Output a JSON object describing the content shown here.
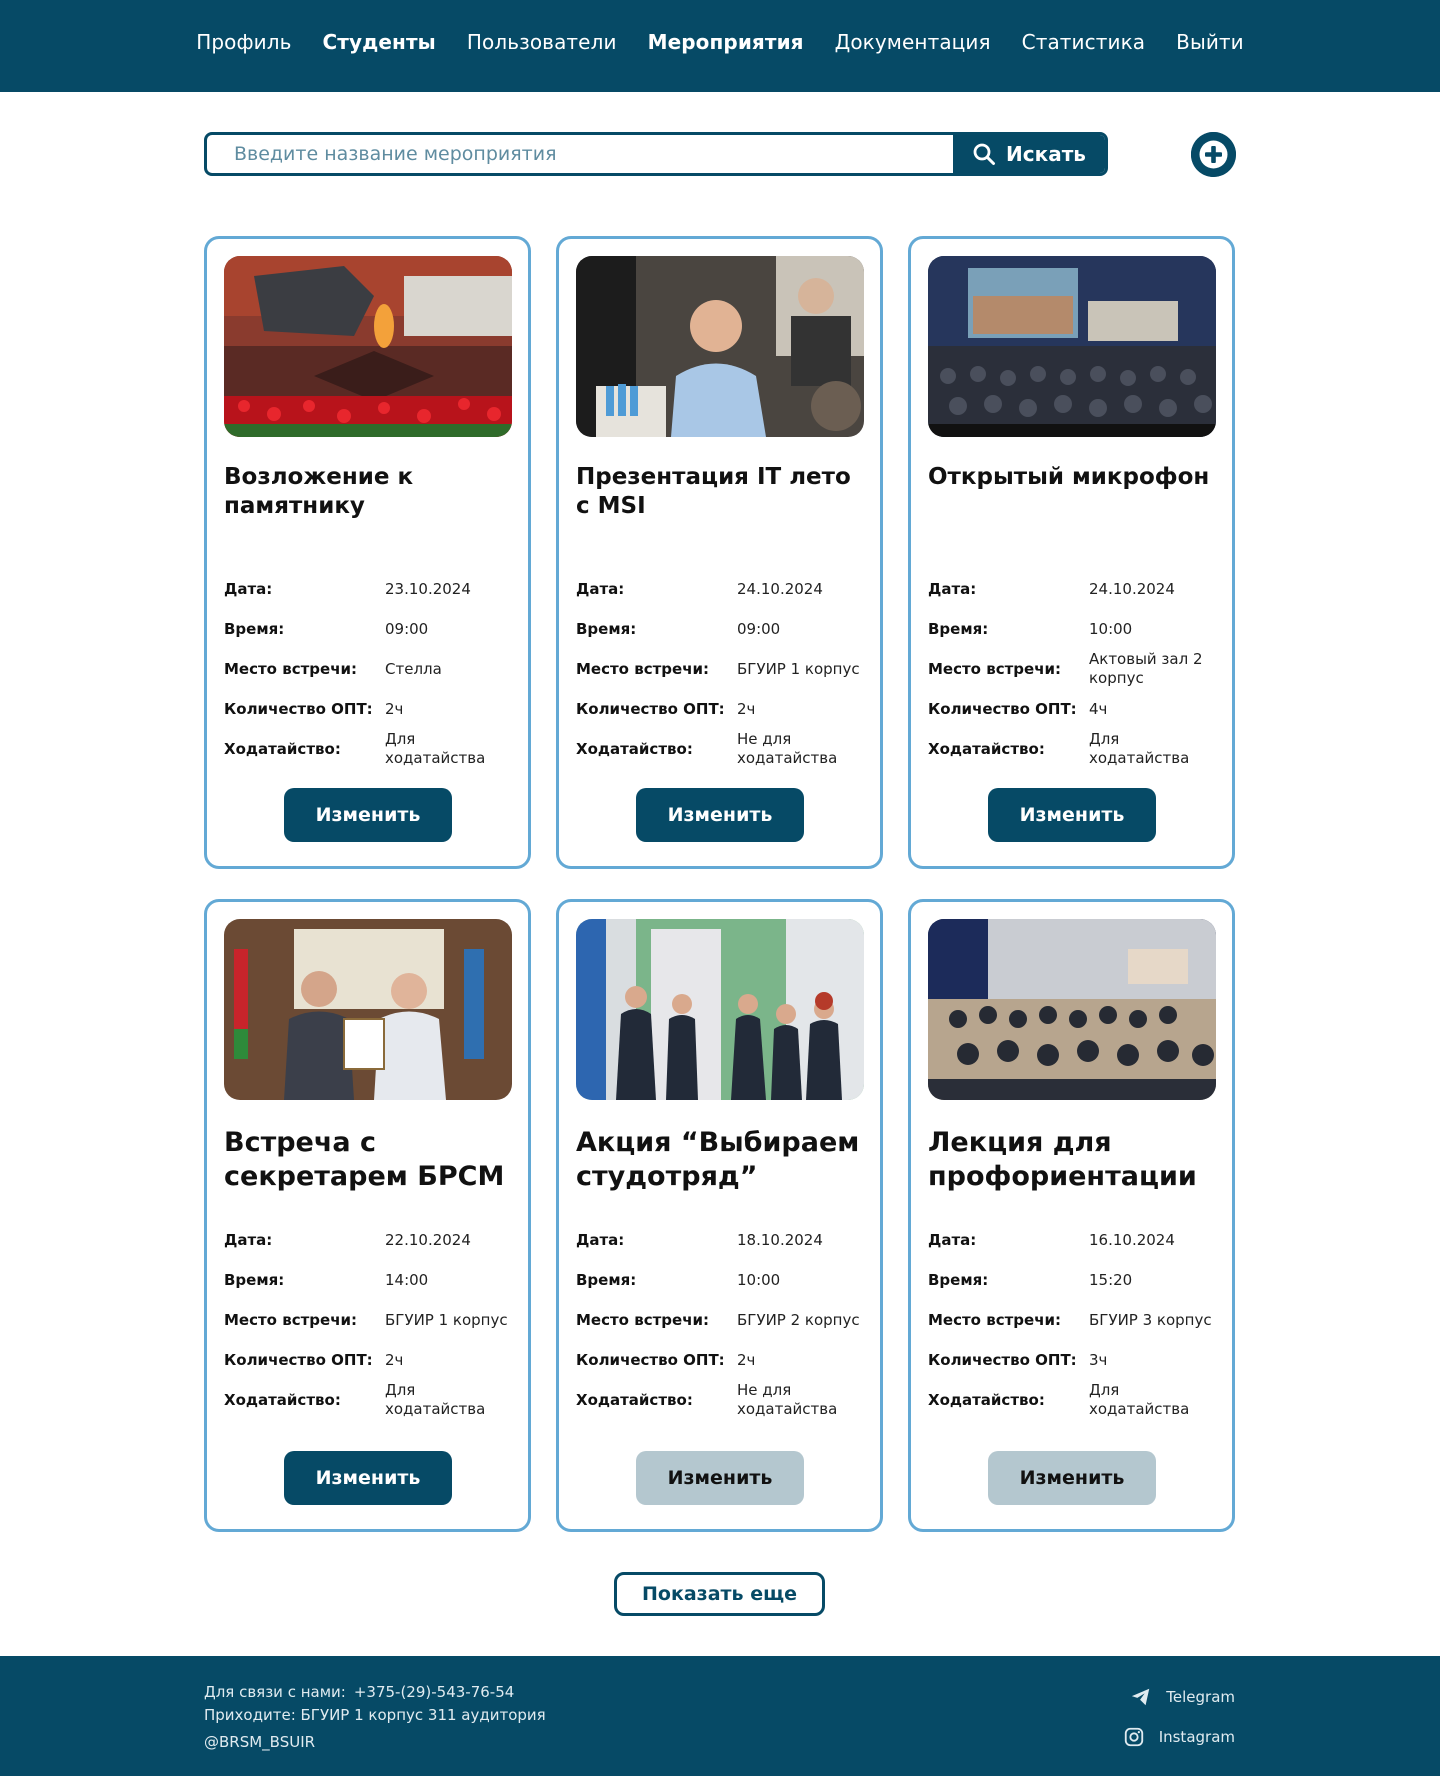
{
  "nav": {
    "items": [
      {
        "label": "Профиль"
      },
      {
        "label": "Студенты"
      },
      {
        "label": "Пользователи"
      },
      {
        "label": "Мероприятия"
      },
      {
        "label": "Документация"
      },
      {
        "label": "Статистика"
      },
      {
        "label": "Выйти"
      }
    ]
  },
  "search": {
    "placeholder": "Введите название мероприятия",
    "value": "",
    "button_label": "Искать",
    "search_icon": "search-icon"
  },
  "add_button": {
    "icon": "plus-icon"
  },
  "labels": {
    "date": "Дата:",
    "time": "Время:",
    "place": "Место встречи:",
    "opt": "Количество ОПТ:",
    "petition": "Ходатайство:"
  },
  "events": [
    {
      "title": "Возложение к памятнику",
      "date": "23.10.2024",
      "time": "09:00",
      "place": "Стелла",
      "opt": "2ч",
      "petition": "Для ходатайства",
      "button": "Изменить"
    },
    {
      "title": "Презентация IT лето с MSI",
      "date": "24.10.2024",
      "time": "09:00",
      "place": "БГУИР 1 корпус",
      "opt": "2ч",
      "petition": "Не для ходатайства",
      "button": "Изменить"
    },
    {
      "title": "Открытый микрофон",
      "date": "24.10.2024",
      "time": "10:00",
      "place": "Актовый зал 2 корпус",
      "opt": "4ч",
      "petition": "Для ходатайства",
      "button": "Изменить"
    },
    {
      "title": "Встреча с секретарем БРСМ",
      "date": "22.10.2024",
      "time": "14:00",
      "place": "БГУИР 1 корпус",
      "opt": "2ч",
      "petition": "Для ходатайства",
      "button": "Изменить"
    },
    {
      "title": "Акция “Выбираем студотряд”",
      "date": "18.10.2024",
      "time": "10:00",
      "place": "БГУИР 2 корпус",
      "opt": "2ч",
      "petition": "Не для ходатайства",
      "button": "Изменить"
    },
    {
      "title": "Лекция для профориентации",
      "date": "16.10.2024",
      "time": "15:20",
      "place": "БГУИР 3 корпус",
      "opt": "3ч",
      "petition": "Для ходатайства",
      "button": "Изменить"
    }
  ],
  "show_more": "Показать еще",
  "footer": {
    "contact_label": "Для связи с нами:",
    "phone": "+375-(29)-543-76-54",
    "address": "Приходите: БГУИР 1 корпус 311 аудитория",
    "handle": "@BRSM_BSUIR",
    "telegram": "Telegram",
    "instagram": "Instagram"
  },
  "colors": {
    "primary": "#064a66",
    "card_border": "#63a9d5",
    "disabled_button": "#b4c7cf"
  }
}
